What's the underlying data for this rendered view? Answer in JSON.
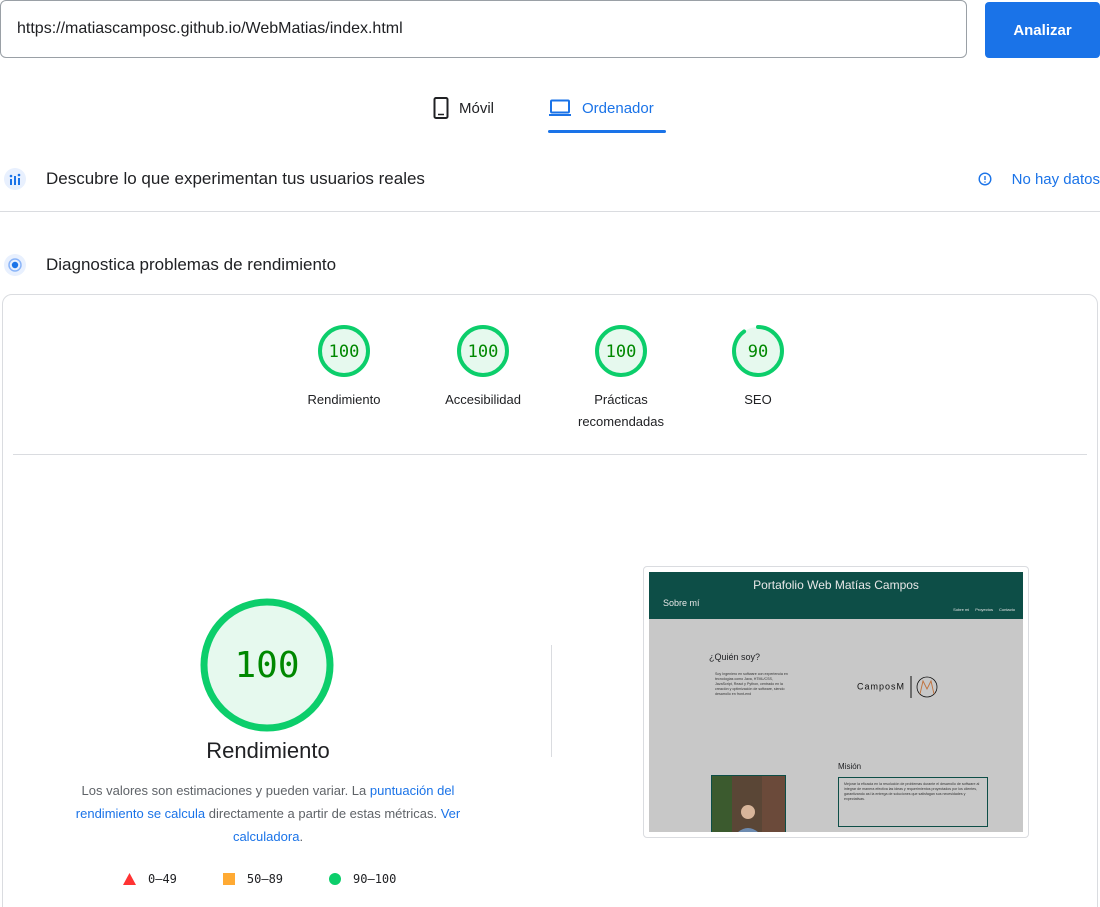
{
  "search": {
    "url": "https://matiascamposc.github.io/WebMatias/index.html",
    "button": "Analizar"
  },
  "device_tabs": {
    "mobile": "Móvil",
    "desktop": "Ordenador",
    "active": "desktop"
  },
  "crux": {
    "title": "Descubre lo que experimentan tus usuarios reales",
    "status": "No hay datos"
  },
  "diagnostics": {
    "title": "Diagnostica problemas de rendimiento"
  },
  "scores": [
    {
      "value": "100",
      "score": 100,
      "label": "Rendimiento"
    },
    {
      "value": "100",
      "score": 100,
      "label": "Accesibilidad"
    },
    {
      "value": "100",
      "score": 100,
      "label": "Prácticas recomendadas"
    },
    {
      "value": "90",
      "score": 90,
      "label": "SEO"
    }
  ],
  "performance": {
    "value": "100",
    "score": 100,
    "title": "Rendimiento",
    "desc_prefix": "Los valores son estimaciones y pueden variar. La ",
    "desc_link1": "puntuación del rendimiento se calcula",
    "desc_middle": " directamente a partir de estas métricas. ",
    "desc_link2": "Ver calculadora",
    "desc_suffix": "."
  },
  "legend": [
    {
      "range": "0–49",
      "color": "#ff3333",
      "shape": "triangle"
    },
    {
      "range": "50–89",
      "color": "#ffaa33",
      "shape": "square"
    },
    {
      "range": "90–100",
      "color": "#0cce6b",
      "shape": "circle"
    }
  ],
  "colors": {
    "accent": "#1a73e8",
    "pass": "#0cce6b",
    "pass_bg": "#e6f9ee",
    "pass_text": "#008800"
  },
  "preview": {
    "title": "Portafolio Web Matías Campos",
    "about": "Sobre mí",
    "nav": [
      "Sobre mi",
      "Proyectos",
      "Contacto"
    ],
    "who": "¿Quién soy?",
    "who_text": "Soy Ingeniero en software con experiencia en tecnologías como Java, HTML/CSS, JavaScript, React y Python, centrado en la creación y optimización de software, siendo desarrollo en front-end",
    "logo": "CamposM",
    "mission": "Misión",
    "mission_text": "Mejorar la eficacia en la resolución de problemas durante el desarrollo de software al integrar de manera efectiva las ideas y requerimientos proyectados por los clientes, garantizando así la entrega de soluciones que satisfagan sus necesidades y expectativas."
  }
}
